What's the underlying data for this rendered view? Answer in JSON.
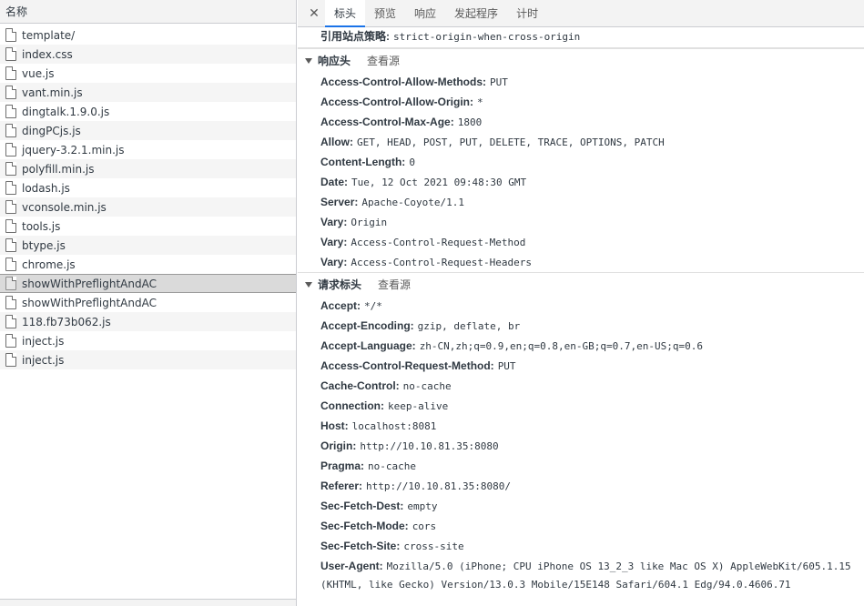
{
  "left_panel": {
    "header": "名称",
    "files": [
      {
        "name": "template/",
        "selected": false
      },
      {
        "name": "index.css",
        "selected": false
      },
      {
        "name": "vue.js",
        "selected": false
      },
      {
        "name": "vant.min.js",
        "selected": false
      },
      {
        "name": "dingtalk.1.9.0.js",
        "selected": false
      },
      {
        "name": "dingPCjs.js",
        "selected": false
      },
      {
        "name": "jquery-3.2.1.min.js",
        "selected": false
      },
      {
        "name": "polyfill.min.js",
        "selected": false
      },
      {
        "name": "lodash.js",
        "selected": false
      },
      {
        "name": "vconsole.min.js",
        "selected": false
      },
      {
        "name": "tools.js",
        "selected": false
      },
      {
        "name": "btype.js",
        "selected": false
      },
      {
        "name": "chrome.js",
        "selected": false
      },
      {
        "name": "showWithPreflightAndAC",
        "selected": true
      },
      {
        "name": "showWithPreflightAndAC",
        "selected": false
      },
      {
        "name": "118.fb73b062.js",
        "selected": false
      },
      {
        "name": "inject.js",
        "selected": false
      },
      {
        "name": "inject.js",
        "selected": false
      }
    ]
  },
  "right_panel": {
    "close_icon": "close-icon",
    "tabs": [
      {
        "label": "标头",
        "active": true
      },
      {
        "label": "预览",
        "active": false
      },
      {
        "label": "响应",
        "active": false
      },
      {
        "label": "发起程序",
        "active": false
      },
      {
        "label": "计时",
        "active": false
      }
    ],
    "referrer_policy": {
      "key": "引用站点策略:",
      "value": "strict-origin-when-cross-origin"
    },
    "response_headers": {
      "title": "响应头",
      "view_source": "查看源",
      "items": [
        {
          "key": "Access-Control-Allow-Methods:",
          "value": "PUT"
        },
        {
          "key": "Access-Control-Allow-Origin:",
          "value": "*"
        },
        {
          "key": "Access-Control-Max-Age:",
          "value": "1800"
        },
        {
          "key": "Allow:",
          "value": "GET, HEAD, POST, PUT, DELETE, TRACE, OPTIONS, PATCH"
        },
        {
          "key": "Content-Length:",
          "value": "0"
        },
        {
          "key": "Date:",
          "value": "Tue, 12 Oct 2021 09:48:30 GMT"
        },
        {
          "key": "Server:",
          "value": "Apache-Coyote/1.1"
        },
        {
          "key": "Vary:",
          "value": "Origin"
        },
        {
          "key": "Vary:",
          "value": "Access-Control-Request-Method"
        },
        {
          "key": "Vary:",
          "value": "Access-Control-Request-Headers"
        }
      ]
    },
    "request_headers": {
      "title": "请求标头",
      "view_source": "查看源",
      "items": [
        {
          "key": "Accept:",
          "value": "*/*"
        },
        {
          "key": "Accept-Encoding:",
          "value": "gzip, deflate, br"
        },
        {
          "key": "Accept-Language:",
          "value": "zh-CN,zh;q=0.9,en;q=0.8,en-GB;q=0.7,en-US;q=0.6"
        },
        {
          "key": "Access-Control-Request-Method:",
          "value": "PUT"
        },
        {
          "key": "Cache-Control:",
          "value": "no-cache"
        },
        {
          "key": "Connection:",
          "value": "keep-alive"
        },
        {
          "key": "Host:",
          "value": "localhost:8081"
        },
        {
          "key": "Origin:",
          "value": "http://10.10.81.35:8080"
        },
        {
          "key": "Pragma:",
          "value": "no-cache"
        },
        {
          "key": "Referer:",
          "value": "http://10.10.81.35:8080/"
        },
        {
          "key": "Sec-Fetch-Dest:",
          "value": "empty"
        },
        {
          "key": "Sec-Fetch-Mode:",
          "value": "cors"
        },
        {
          "key": "Sec-Fetch-Site:",
          "value": "cross-site"
        },
        {
          "key": "User-Agent:",
          "value": "Mozilla/5.0 (iPhone; CPU iPhone OS 13_2_3 like Mac OS X) AppleWebKit/605.1.15"
        }
      ],
      "user_agent_continuation": "(KHTML, like Gecko) Version/13.0.3 Mobile/15E148 Safari/604.1 Edg/94.0.4606.71"
    }
  }
}
